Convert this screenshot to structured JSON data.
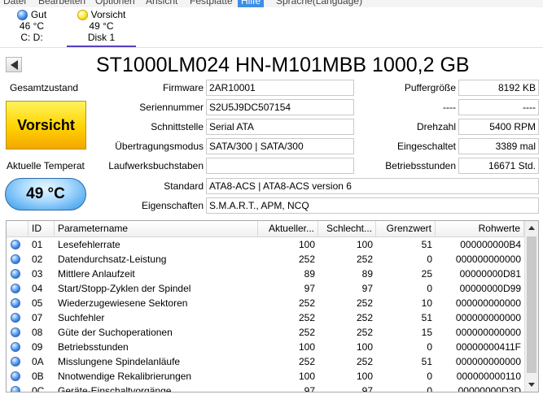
{
  "menu": {
    "items": [
      "Datei",
      "Bearbeiten",
      "Optionen",
      "Ansicht",
      "Festplatte",
      "Hilfe",
      "Sprache(Language)"
    ],
    "active_index": 5
  },
  "disk_tabs": [
    {
      "status": "Gut",
      "temperature": "46 °C",
      "drive": "C: D:",
      "status_color": "#3a7fe0"
    },
    {
      "status": "Vorsicht",
      "temperature": "49 °C",
      "drive": "Disk 1",
      "status_color": "#f2d400",
      "selected": true
    }
  ],
  "header": {
    "back_icon": "back-arrow-icon",
    "title": "ST1000LM024 HN-M101MBB 1000,2 GB"
  },
  "status": {
    "health_label": "Gesamtzustand",
    "health_value": "Vorsicht",
    "health_color": "#ffd200",
    "temp_label": "Aktuelle Temperat",
    "temp_value": "49 °C",
    "temp_color": "#7fc4ff"
  },
  "properties": {
    "firmware_label": "Firmware",
    "firmware": "2AR10001",
    "serial_label": "Seriennummer",
    "serial": "S2U5J9DC507154",
    "interface_label": "Schnittstelle",
    "interface": "Serial ATA",
    "transfer_label": "Übertragungsmodus",
    "transfer": "SATA/300 | SATA/300",
    "drive_letters_label": "Laufwerksbuchstaben",
    "drive_letters": "",
    "standard_label": "Standard",
    "standard": "ATA8-ACS | ATA8-ACS version 6",
    "features_label": "Eigenschaften",
    "features": "S.M.A.R.T., APM, NCQ",
    "buffer_label": "Puffergröße",
    "buffer": "8192 KB",
    "dash1_label": "----",
    "dash1": "----",
    "rpm_label": "Drehzahl",
    "rpm": "5400 RPM",
    "power_on_count_label": "Eingeschaltet",
    "power_on_count": "3389 mal",
    "power_on_hours_label": "Betriebsstunden",
    "power_on_hours": "16671 Std."
  },
  "smart_table": {
    "columns": [
      "ID",
      "Parametername",
      "Aktueller...",
      "Schlecht...",
      "Grenzwert",
      "Rohwerte"
    ],
    "rows": [
      {
        "id": "01",
        "name": "Lesefehlerrate",
        "current": "100",
        "worst": "100",
        "threshold": "51",
        "raw": "000000000B4"
      },
      {
        "id": "02",
        "name": "Datendurchsatz-Leistung",
        "current": "252",
        "worst": "252",
        "threshold": "0",
        "raw": "000000000000"
      },
      {
        "id": "03",
        "name": "Mittlere Anlaufzeit",
        "current": "89",
        "worst": "89",
        "threshold": "25",
        "raw": "00000000D81"
      },
      {
        "id": "04",
        "name": "Start/Stopp-Zyklen der Spindel",
        "current": "97",
        "worst": "97",
        "threshold": "0",
        "raw": "00000000D99"
      },
      {
        "id": "05",
        "name": "Wiederzugewiesene Sektoren",
        "current": "252",
        "worst": "252",
        "threshold": "10",
        "raw": "000000000000"
      },
      {
        "id": "07",
        "name": "Suchfehler",
        "current": "252",
        "worst": "252",
        "threshold": "51",
        "raw": "000000000000"
      },
      {
        "id": "08",
        "name": "Güte der Suchoperationen",
        "current": "252",
        "worst": "252",
        "threshold": "15",
        "raw": "000000000000"
      },
      {
        "id": "09",
        "name": "Betriebsstunden",
        "current": "100",
        "worst": "100",
        "threshold": "0",
        "raw": "00000000411F"
      },
      {
        "id": "0A",
        "name": "Misslungene Spindelanläufe",
        "current": "252",
        "worst": "252",
        "threshold": "51",
        "raw": "000000000000"
      },
      {
        "id": "0B",
        "name": "Nnotwendige Rekalibrierungen",
        "current": "100",
        "worst": "100",
        "threshold": "0",
        "raw": "000000000110"
      },
      {
        "id": "0C",
        "name": "Geräte-Einschaltvorgänge",
        "current": "97",
        "worst": "97",
        "threshold": "0",
        "raw": "00000000D3D"
      }
    ]
  }
}
